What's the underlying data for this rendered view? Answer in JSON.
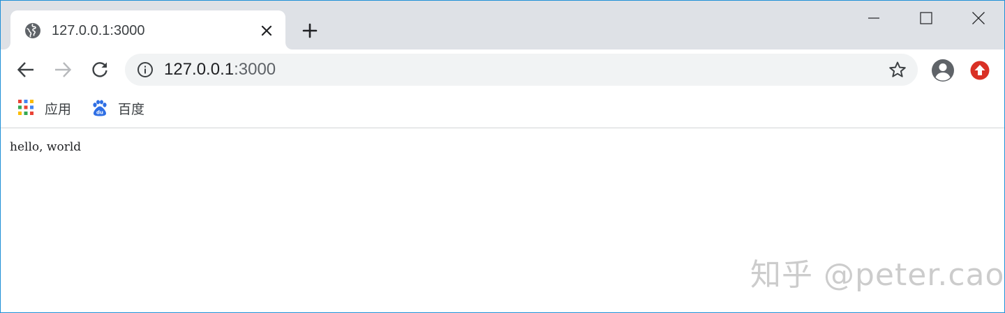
{
  "tab": {
    "title": "127.0.0.1:3000",
    "favicon": "globe-icon"
  },
  "toolbar": {
    "url_host": "127.0.0.1",
    "url_port": ":3000"
  },
  "bookmarks": [
    {
      "label": "应用",
      "icon": "apps-grid-icon"
    },
    {
      "label": "百度",
      "icon": "baidu-paw-icon"
    }
  ],
  "page": {
    "text": "hello, world"
  },
  "watermark": "知乎 @peter.cao",
  "colors": {
    "tabstrip": "#dee1e6",
    "omnibox": "#f1f3f4",
    "icon_gray": "#5f6368",
    "extension_red": "#d93025",
    "window_border": "#1e8fd6"
  }
}
